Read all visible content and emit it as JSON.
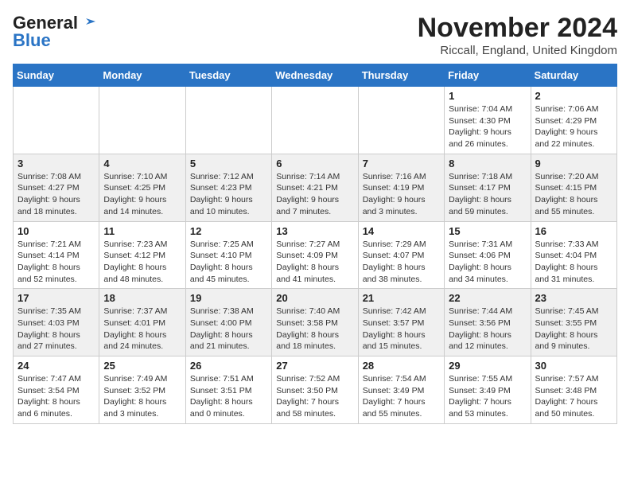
{
  "logo": {
    "general": "General",
    "blue": "Blue"
  },
  "title": "November 2024",
  "subtitle": "Riccall, England, United Kingdom",
  "days_of_week": [
    "Sunday",
    "Monday",
    "Tuesday",
    "Wednesday",
    "Thursday",
    "Friday",
    "Saturday"
  ],
  "weeks": [
    [
      {
        "day": "",
        "info": ""
      },
      {
        "day": "",
        "info": ""
      },
      {
        "day": "",
        "info": ""
      },
      {
        "day": "",
        "info": ""
      },
      {
        "day": "",
        "info": ""
      },
      {
        "day": "1",
        "info": "Sunrise: 7:04 AM\nSunset: 4:30 PM\nDaylight: 9 hours and 26 minutes."
      },
      {
        "day": "2",
        "info": "Sunrise: 7:06 AM\nSunset: 4:29 PM\nDaylight: 9 hours and 22 minutes."
      }
    ],
    [
      {
        "day": "3",
        "info": "Sunrise: 7:08 AM\nSunset: 4:27 PM\nDaylight: 9 hours and 18 minutes."
      },
      {
        "day": "4",
        "info": "Sunrise: 7:10 AM\nSunset: 4:25 PM\nDaylight: 9 hours and 14 minutes."
      },
      {
        "day": "5",
        "info": "Sunrise: 7:12 AM\nSunset: 4:23 PM\nDaylight: 9 hours and 10 minutes."
      },
      {
        "day": "6",
        "info": "Sunrise: 7:14 AM\nSunset: 4:21 PM\nDaylight: 9 hours and 7 minutes."
      },
      {
        "day": "7",
        "info": "Sunrise: 7:16 AM\nSunset: 4:19 PM\nDaylight: 9 hours and 3 minutes."
      },
      {
        "day": "8",
        "info": "Sunrise: 7:18 AM\nSunset: 4:17 PM\nDaylight: 8 hours and 59 minutes."
      },
      {
        "day": "9",
        "info": "Sunrise: 7:20 AM\nSunset: 4:15 PM\nDaylight: 8 hours and 55 minutes."
      }
    ],
    [
      {
        "day": "10",
        "info": "Sunrise: 7:21 AM\nSunset: 4:14 PM\nDaylight: 8 hours and 52 minutes."
      },
      {
        "day": "11",
        "info": "Sunrise: 7:23 AM\nSunset: 4:12 PM\nDaylight: 8 hours and 48 minutes."
      },
      {
        "day": "12",
        "info": "Sunrise: 7:25 AM\nSunset: 4:10 PM\nDaylight: 8 hours and 45 minutes."
      },
      {
        "day": "13",
        "info": "Sunrise: 7:27 AM\nSunset: 4:09 PM\nDaylight: 8 hours and 41 minutes."
      },
      {
        "day": "14",
        "info": "Sunrise: 7:29 AM\nSunset: 4:07 PM\nDaylight: 8 hours and 38 minutes."
      },
      {
        "day": "15",
        "info": "Sunrise: 7:31 AM\nSunset: 4:06 PM\nDaylight: 8 hours and 34 minutes."
      },
      {
        "day": "16",
        "info": "Sunrise: 7:33 AM\nSunset: 4:04 PM\nDaylight: 8 hours and 31 minutes."
      }
    ],
    [
      {
        "day": "17",
        "info": "Sunrise: 7:35 AM\nSunset: 4:03 PM\nDaylight: 8 hours and 27 minutes."
      },
      {
        "day": "18",
        "info": "Sunrise: 7:37 AM\nSunset: 4:01 PM\nDaylight: 8 hours and 24 minutes."
      },
      {
        "day": "19",
        "info": "Sunrise: 7:38 AM\nSunset: 4:00 PM\nDaylight: 8 hours and 21 minutes."
      },
      {
        "day": "20",
        "info": "Sunrise: 7:40 AM\nSunset: 3:58 PM\nDaylight: 8 hours and 18 minutes."
      },
      {
        "day": "21",
        "info": "Sunrise: 7:42 AM\nSunset: 3:57 PM\nDaylight: 8 hours and 15 minutes."
      },
      {
        "day": "22",
        "info": "Sunrise: 7:44 AM\nSunset: 3:56 PM\nDaylight: 8 hours and 12 minutes."
      },
      {
        "day": "23",
        "info": "Sunrise: 7:45 AM\nSunset: 3:55 PM\nDaylight: 8 hours and 9 minutes."
      }
    ],
    [
      {
        "day": "24",
        "info": "Sunrise: 7:47 AM\nSunset: 3:54 PM\nDaylight: 8 hours and 6 minutes."
      },
      {
        "day": "25",
        "info": "Sunrise: 7:49 AM\nSunset: 3:52 PM\nDaylight: 8 hours and 3 minutes."
      },
      {
        "day": "26",
        "info": "Sunrise: 7:51 AM\nSunset: 3:51 PM\nDaylight: 8 hours and 0 minutes."
      },
      {
        "day": "27",
        "info": "Sunrise: 7:52 AM\nSunset: 3:50 PM\nDaylight: 7 hours and 58 minutes."
      },
      {
        "day": "28",
        "info": "Sunrise: 7:54 AM\nSunset: 3:49 PM\nDaylight: 7 hours and 55 minutes."
      },
      {
        "day": "29",
        "info": "Sunrise: 7:55 AM\nSunset: 3:49 PM\nDaylight: 7 hours and 53 minutes."
      },
      {
        "day": "30",
        "info": "Sunrise: 7:57 AM\nSunset: 3:48 PM\nDaylight: 7 hours and 50 minutes."
      }
    ]
  ]
}
